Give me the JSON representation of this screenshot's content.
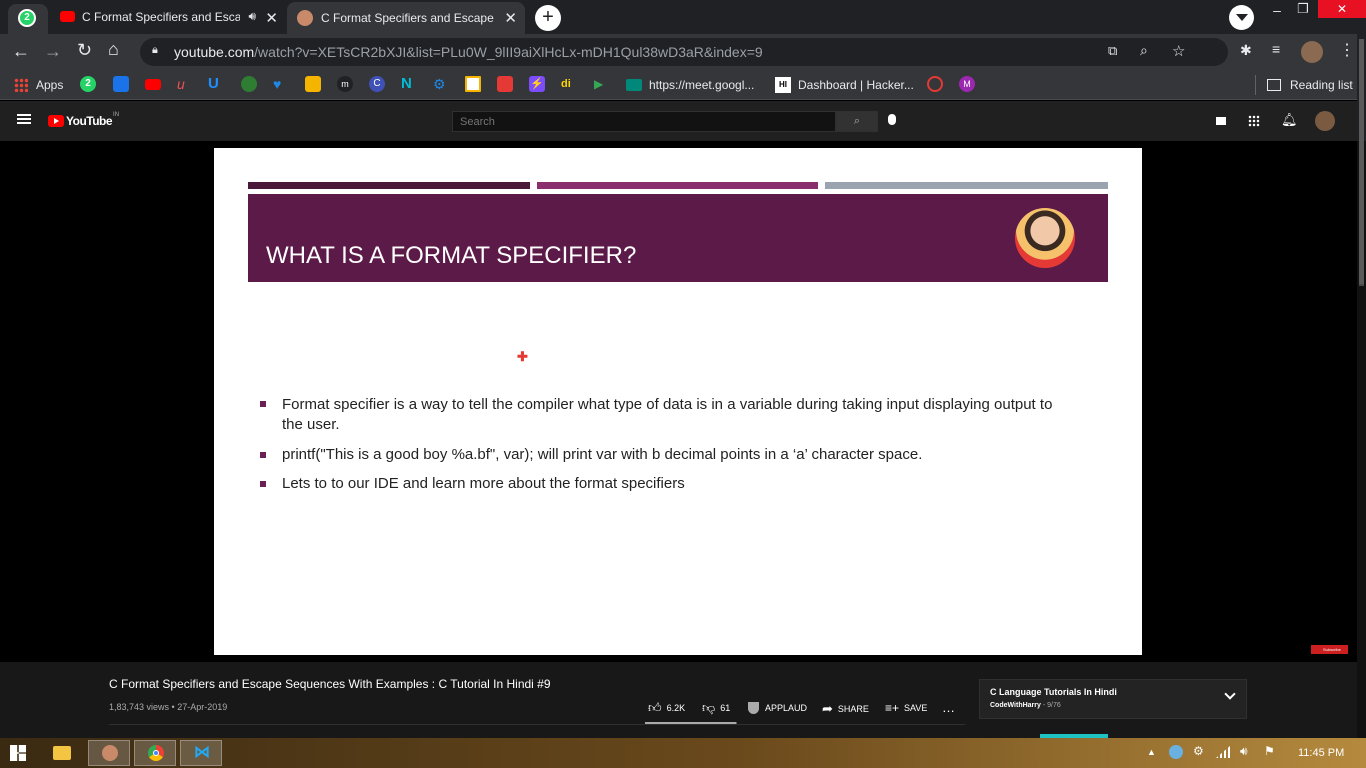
{
  "browser": {
    "tab_count_badge": "2",
    "tabs": [
      {
        "title": "C Format Specifiers and Escape Se",
        "active": false
      },
      {
        "title": "C Format Specifiers and Escape S",
        "active": true
      }
    ],
    "url_host": "youtube.com",
    "url_path": "/watch?v=XETsCR2bXJI&list=PLu0W_9lII9aiXlHcLx-mDH1Qul38wD3aR&index=9",
    "bookmarks": {
      "apps_label": "Apps",
      "badge_count": "2",
      "meet_label": "https://meet.googl...",
      "hacker_label": "Dashboard | Hacker...",
      "hacker_icon_text": "HI",
      "reading_list_label": "Reading list"
    }
  },
  "youtube": {
    "logo_text": "YouTube",
    "logo_region": "IN",
    "search_placeholder": "Search"
  },
  "slide": {
    "title": "WHAT IS A FORMAT SPECIFIER?",
    "bullets": [
      "Format specifier is a way to tell the compiler what type of data is in a variable during taking input displaying output to the user.",
      "printf(\"This is a good boy %a.bf\", var); will print var with b decimal points in a ‘a’ character space.",
      "Lets to to our IDE and learn more about the format specifiers"
    ],
    "colors": {
      "band": "#5b1a48",
      "bar1": "#4a1838",
      "bar2": "#8a2e6e",
      "bar3": "#9aa3b0"
    },
    "subscribe_text": "Subscribe"
  },
  "video": {
    "title": "C Format Specifiers and Escape Sequences With Examples : C Tutorial In Hindi #9",
    "views": "1,83,743 views",
    "date": "27-Apr-2019",
    "likes": "6.2K",
    "dislikes": "61",
    "applaud_label": "APPLAUD",
    "share_label": "SHARE",
    "save_label": "SAVE"
  },
  "playlist": {
    "title": "C Language Tutorials In Hindi",
    "channel": "CodeWithHarry",
    "position": "9/76"
  },
  "taskbar": {
    "time": "11:45 PM"
  }
}
